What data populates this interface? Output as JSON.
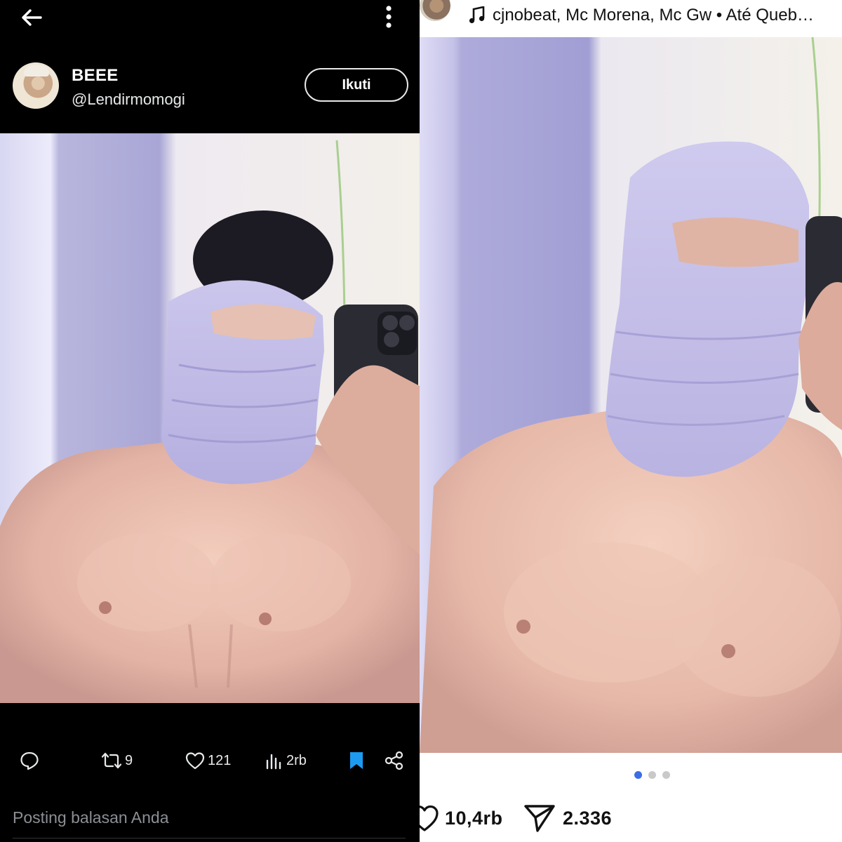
{
  "left_post": {
    "author": {
      "display_name": "BEEE",
      "handle": "@Lendirmomogi"
    },
    "follow_label": "Ikuti",
    "stats": {
      "retweets": "9",
      "likes": "121",
      "views": "2rb"
    },
    "reply_placeholder": "Posting balasan Anda",
    "icons": [
      "back-arrow-icon",
      "more-vertical-icon",
      "reply-icon",
      "retweet-icon",
      "heart-icon",
      "views-icon",
      "bookmark-icon",
      "share-icon"
    ],
    "colors": {
      "background": "#000000",
      "text": "#e7e9ea",
      "bookmark_active": "#1d9bf0"
    }
  },
  "right_post": {
    "music": "cjnobeat, Mc Morena, Mc Gw • Até Queb…",
    "carousel": {
      "total": 3,
      "active": 1
    },
    "stats": {
      "likes": "10,4rb",
      "shares": "2.336"
    },
    "icons": [
      "music-note-icon",
      "heart-outline-icon",
      "send-icon"
    ],
    "colors": {
      "background": "#ffffff",
      "dot_active": "#3b6ee6",
      "dot_inactive": "#c9c9c9"
    }
  }
}
